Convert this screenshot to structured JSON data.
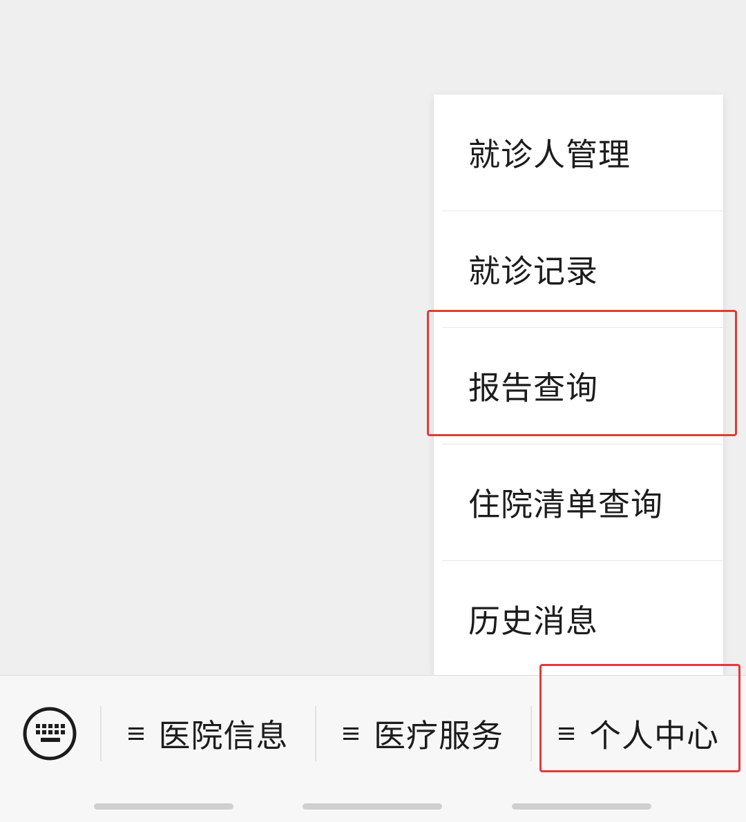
{
  "submenu": {
    "items": [
      {
        "label": "就诊人管理"
      },
      {
        "label": "就诊记录"
      },
      {
        "label": "报告查询"
      },
      {
        "label": "住院清单查询"
      },
      {
        "label": "历史消息"
      }
    ],
    "highlighted_item": "报告查询"
  },
  "menubar": {
    "keyboard_icon": "keyboard-icon",
    "tabs": [
      {
        "label": "医院信息",
        "icon": "menu-lines-icon"
      },
      {
        "label": "医疗服务",
        "icon": "menu-lines-icon"
      },
      {
        "label": "个人中心",
        "icon": "menu-lines-icon",
        "highlighted": true
      }
    ]
  },
  "colors": {
    "background": "#efefef",
    "menubar_background": "#f7f7f7",
    "text": "#1c1c1c",
    "highlight": "#e53935"
  }
}
